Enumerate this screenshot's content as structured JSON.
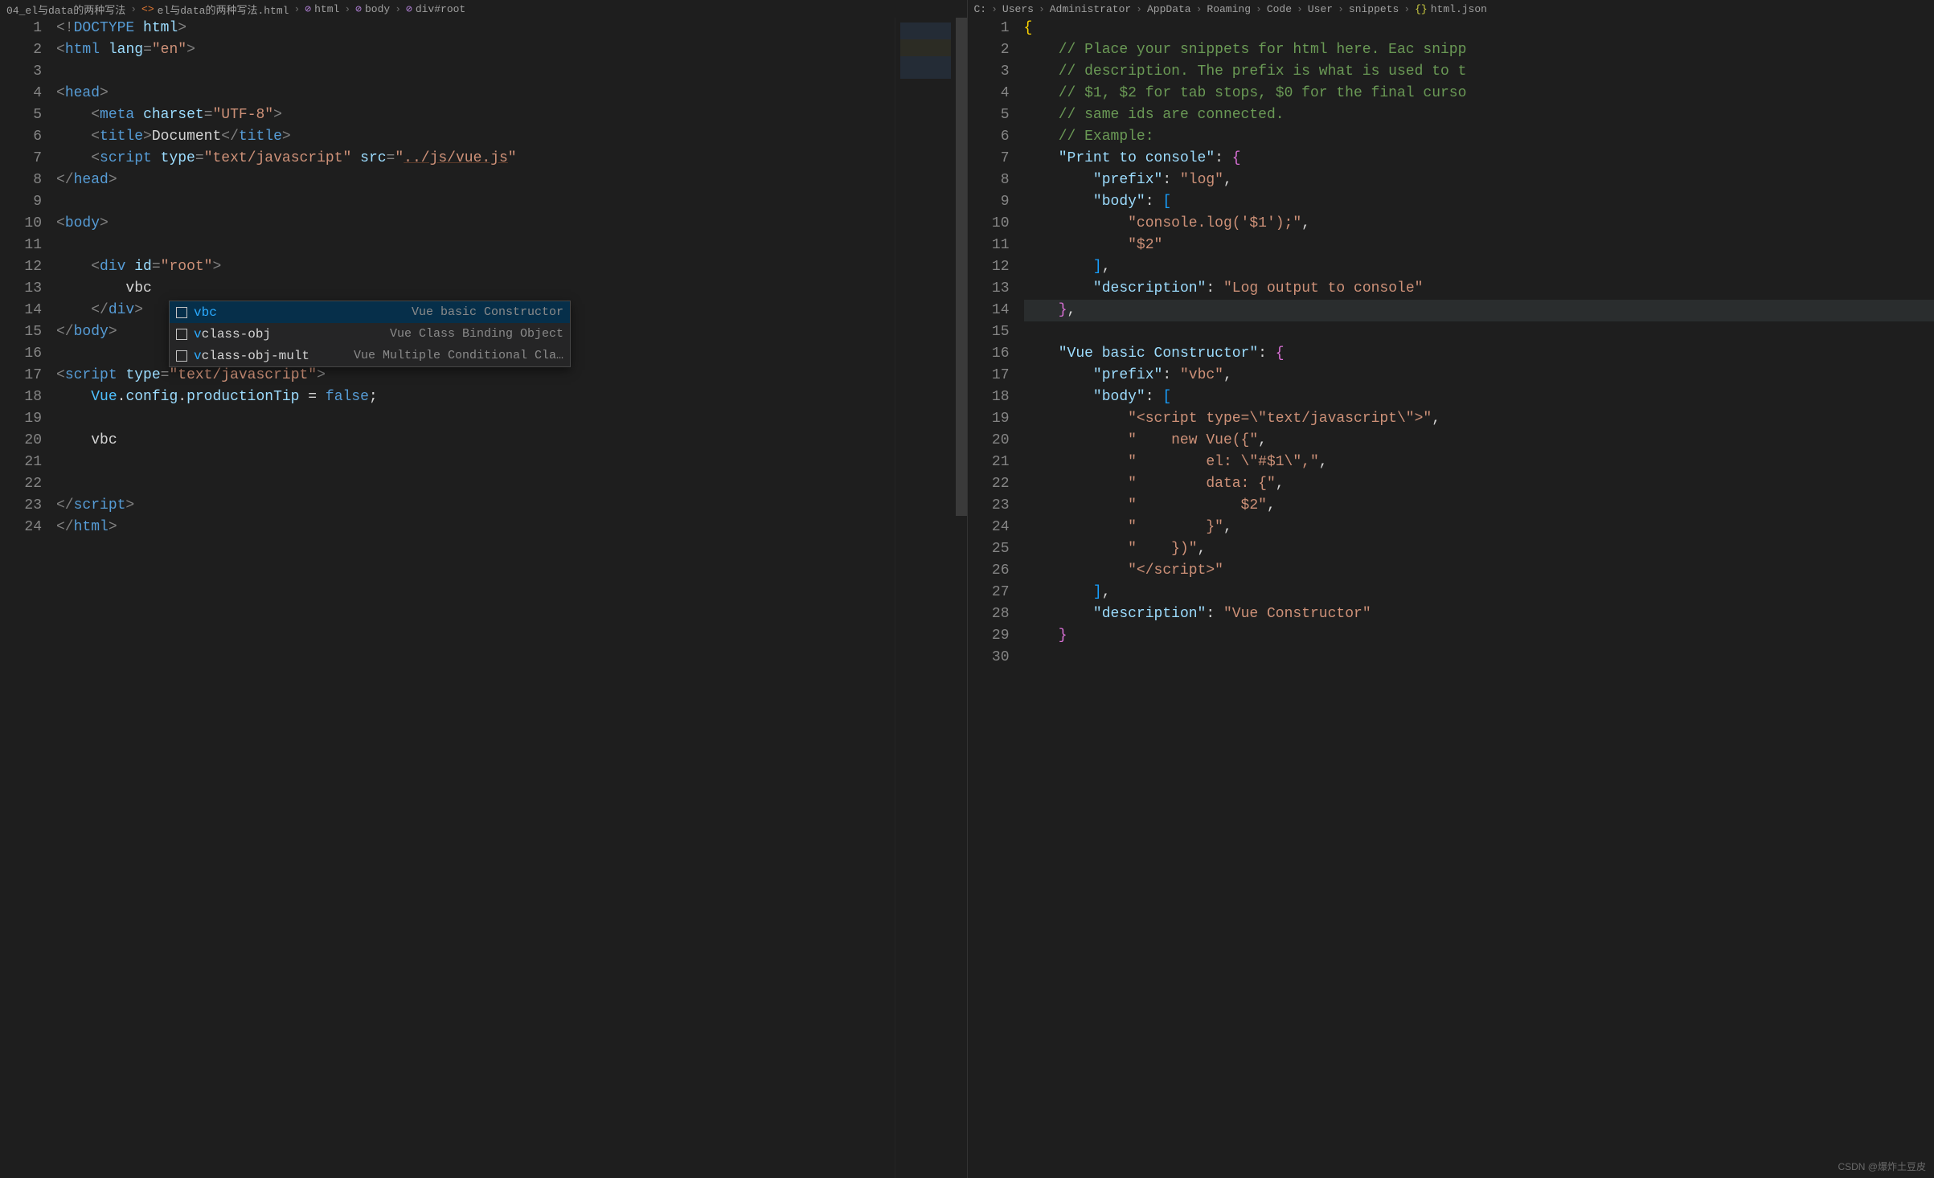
{
  "left": {
    "breadcrumbs": [
      {
        "icon": "",
        "label": "04_el与data的两种写法"
      },
      {
        "icon": "<>",
        "iconClass": "icon-html",
        "label": "el与data的两种写法.html"
      },
      {
        "icon": "⊘",
        "iconClass": "icon-sym",
        "label": "html"
      },
      {
        "icon": "⊘",
        "iconClass": "icon-sym",
        "label": "body"
      },
      {
        "icon": "⊘",
        "iconClass": "icon-sym",
        "label": "div#root"
      }
    ],
    "lineCount": 24,
    "code": {
      "l1": [
        [
          "<!",
          "t-pun"
        ],
        [
          "DOCTYPE",
          "t-tag"
        ],
        [
          " ",
          "t-txt"
        ],
        [
          "html",
          "t-attr"
        ],
        [
          ">",
          "t-pun"
        ]
      ],
      "l2": [
        [
          "<",
          "t-pun"
        ],
        [
          "html",
          "t-tag"
        ],
        [
          " ",
          "t-txt"
        ],
        [
          "lang",
          "t-attr"
        ],
        [
          "=",
          "t-pun"
        ],
        [
          "\"en\"",
          "t-str"
        ],
        [
          ">",
          "t-pun"
        ]
      ],
      "l3": [
        [
          "",
          "t-txt"
        ]
      ],
      "l4": [
        [
          "<",
          "t-pun"
        ],
        [
          "head",
          "t-tag"
        ],
        [
          ">",
          "t-pun"
        ]
      ],
      "l5": [
        [
          "    ",
          "t-txt"
        ],
        [
          "<",
          "t-pun"
        ],
        [
          "meta",
          "t-tag"
        ],
        [
          " ",
          "t-txt"
        ],
        [
          "charset",
          "t-attr"
        ],
        [
          "=",
          "t-pun"
        ],
        [
          "\"UTF-8\"",
          "t-str"
        ],
        [
          ">",
          "t-pun"
        ]
      ],
      "l6": [
        [
          "    ",
          "t-txt"
        ],
        [
          "<",
          "t-pun"
        ],
        [
          "title",
          "t-tag"
        ],
        [
          ">",
          "t-pun"
        ],
        [
          "Document",
          "t-txt"
        ],
        [
          "</",
          "t-pun"
        ],
        [
          "title",
          "t-tag"
        ],
        [
          ">",
          "t-pun"
        ]
      ],
      "l7": [
        [
          "    ",
          "t-txt"
        ],
        [
          "<",
          "t-pun"
        ],
        [
          "script",
          "t-tag"
        ],
        [
          " ",
          "t-txt"
        ],
        [
          "type",
          "t-attr"
        ],
        [
          "=",
          "t-pun"
        ],
        [
          "\"text/javascript\"",
          "t-str"
        ],
        [
          " ",
          "t-txt"
        ],
        [
          "src",
          "t-attr"
        ],
        [
          "=",
          "t-pun"
        ],
        [
          "\"",
          "t-str"
        ],
        [
          "../js/vue.js",
          "t-link"
        ],
        [
          "\"",
          "t-str"
        ]
      ],
      "l8": [
        [
          "</",
          "t-pun"
        ],
        [
          "head",
          "t-tag"
        ],
        [
          ">",
          "t-pun"
        ]
      ],
      "l9": [
        [
          "",
          "t-txt"
        ]
      ],
      "l10": [
        [
          "<",
          "t-pun"
        ],
        [
          "body",
          "t-tag"
        ],
        [
          ">",
          "t-pun"
        ]
      ],
      "l11": [
        [
          "",
          "t-txt"
        ]
      ],
      "l12": [
        [
          "    ",
          "t-txt"
        ],
        [
          "<",
          "t-pun"
        ],
        [
          "div",
          "t-tag"
        ],
        [
          " ",
          "t-txt"
        ],
        [
          "id",
          "t-attr"
        ],
        [
          "=",
          "t-pun"
        ],
        [
          "\"root\"",
          "t-str"
        ],
        [
          ">",
          "t-pun"
        ]
      ],
      "l13": [
        [
          "        vbc",
          "t-txt"
        ]
      ],
      "l14": [
        [
          "    ",
          "t-txt"
        ],
        [
          "</",
          "t-pun"
        ],
        [
          "div",
          "t-tag"
        ],
        [
          ">",
          "t-pun"
        ]
      ],
      "l15": [
        [
          "</",
          "t-pun"
        ],
        [
          "body",
          "t-tag"
        ],
        [
          ">",
          "t-pun"
        ]
      ],
      "l16": [
        [
          "",
          "t-txt"
        ]
      ],
      "l17": [
        [
          "<",
          "t-pun"
        ],
        [
          "script",
          "t-tag"
        ],
        [
          " ",
          "t-txt"
        ],
        [
          "type",
          "t-attr"
        ],
        [
          "=",
          "t-pun"
        ],
        [
          "\"text/javascript\"",
          "t-str"
        ],
        [
          ">",
          "t-pun"
        ]
      ],
      "l18": [
        [
          "    ",
          "t-txt"
        ],
        [
          "Vue",
          "t-var"
        ],
        [
          ".",
          "t-txt"
        ],
        [
          "config",
          "t-prop"
        ],
        [
          ".",
          "t-txt"
        ],
        [
          "productionTip",
          "t-prop"
        ],
        [
          " = ",
          "t-txt"
        ],
        [
          "false",
          "t-bool"
        ],
        [
          ";",
          "t-txt"
        ]
      ],
      "l19": [
        [
          "",
          "t-txt"
        ]
      ],
      "l20": [
        [
          "    ",
          "t-txt"
        ],
        [
          "vbc",
          "t-txt"
        ]
      ],
      "l21": [
        [
          "",
          "t-txt"
        ]
      ],
      "l22": [
        [
          "",
          "t-txt"
        ]
      ],
      "l23": [
        [
          "</",
          "t-pun"
        ],
        [
          "script",
          "t-tag"
        ],
        [
          ">",
          "t-pun"
        ]
      ],
      "l24": [
        [
          "</",
          "t-pun"
        ],
        [
          "html",
          "t-tag"
        ],
        [
          ">",
          "t-pun"
        ]
      ]
    },
    "suggest": [
      {
        "name": "vbc",
        "match": "vbc",
        "desc": "Vue basic Constructor",
        "selected": true
      },
      {
        "name": "vclass-obj",
        "match": "v",
        "desc": "Vue Class Binding Object",
        "selected": false
      },
      {
        "name": "vclass-obj-mult",
        "match": "v",
        "desc": "Vue Multiple Conditional Cla…",
        "selected": false
      }
    ]
  },
  "right": {
    "breadcrumbs": [
      {
        "label": "C:"
      },
      {
        "label": "Users"
      },
      {
        "label": "Administrator"
      },
      {
        "label": "AppData"
      },
      {
        "label": "Roaming"
      },
      {
        "label": "Code"
      },
      {
        "label": "User"
      },
      {
        "label": "snippets"
      },
      {
        "icon": "{}",
        "iconClass": "icon-json",
        "label": "html.json"
      }
    ],
    "lineCount": 30,
    "code": {
      "l1": [
        [
          "{",
          "t-brace"
        ]
      ],
      "l2": [
        [
          "    ",
          "t-txt"
        ],
        [
          "// Place your snippets for html here. Eac snipp",
          "t-com"
        ]
      ],
      "l3": [
        [
          "    ",
          "t-txt"
        ],
        [
          "// description. The prefix is what is used to t",
          "t-com"
        ]
      ],
      "l4": [
        [
          "    ",
          "t-txt"
        ],
        [
          "// $1, $2 for tab stops, $0 for the final curso",
          "t-com"
        ]
      ],
      "l5": [
        [
          "    ",
          "t-txt"
        ],
        [
          "// same ids are connected.",
          "t-com"
        ]
      ],
      "l6": [
        [
          "    ",
          "t-txt"
        ],
        [
          "// Example:",
          "t-com"
        ]
      ],
      "l7": [
        [
          "    ",
          "t-txt"
        ],
        [
          "\"Print to console\"",
          "t-key"
        ],
        [
          ":",
          "t-txt"
        ],
        [
          " ",
          "t-txt"
        ],
        [
          "{",
          "t-brace2"
        ]
      ],
      "l8": [
        [
          "        ",
          "t-txt"
        ],
        [
          "\"prefix\"",
          "t-key"
        ],
        [
          ":",
          "t-txt"
        ],
        [
          " ",
          "t-txt"
        ],
        [
          "\"log\"",
          "t-str"
        ],
        [
          ",",
          "t-txt"
        ]
      ],
      "l9": [
        [
          "        ",
          "t-txt"
        ],
        [
          "\"body\"",
          "t-key"
        ],
        [
          ":",
          "t-txt"
        ],
        [
          " ",
          "t-txt"
        ],
        [
          "[",
          "t-brace3"
        ]
      ],
      "l10": [
        [
          "            ",
          "t-txt"
        ],
        [
          "\"console.log('$1');\"",
          "t-str"
        ],
        [
          ",",
          "t-txt"
        ]
      ],
      "l11": [
        [
          "            ",
          "t-txt"
        ],
        [
          "\"$2\"",
          "t-str"
        ]
      ],
      "l12": [
        [
          "        ",
          "t-txt"
        ],
        [
          "]",
          "t-brace3"
        ],
        [
          ",",
          "t-txt"
        ]
      ],
      "l13": [
        [
          "        ",
          "t-txt"
        ],
        [
          "\"description\"",
          "t-key"
        ],
        [
          ":",
          "t-txt"
        ],
        [
          " ",
          "t-txt"
        ],
        [
          "\"Log output to console\"",
          "t-str"
        ]
      ],
      "l14": [
        [
          "    ",
          "t-txt"
        ],
        [
          "}",
          "t-brace2"
        ],
        [
          ",",
          "t-txt"
        ]
      ],
      "l15": [
        [
          "",
          "t-txt"
        ]
      ],
      "l16": [
        [
          "    ",
          "t-txt"
        ],
        [
          "\"Vue basic Constructor\"",
          "t-key"
        ],
        [
          ":",
          "t-txt"
        ],
        [
          " ",
          "t-txt"
        ],
        [
          "{",
          "t-brace2"
        ]
      ],
      "l17": [
        [
          "        ",
          "t-txt"
        ],
        [
          "\"prefix\"",
          "t-key"
        ],
        [
          ":",
          "t-txt"
        ],
        [
          " ",
          "t-txt"
        ],
        [
          "\"vbc\"",
          "t-str"
        ],
        [
          ",",
          "t-txt"
        ]
      ],
      "l18": [
        [
          "        ",
          "t-txt"
        ],
        [
          "\"body\"",
          "t-key"
        ],
        [
          ":",
          "t-txt"
        ],
        [
          " ",
          "t-txt"
        ],
        [
          "[",
          "t-brace3"
        ]
      ],
      "l19": [
        [
          "            ",
          "t-txt"
        ],
        [
          "\"<script type=\\\"text/javascript\\\">\"",
          "t-str"
        ],
        [
          ",",
          "t-txt"
        ]
      ],
      "l20": [
        [
          "            ",
          "t-txt"
        ],
        [
          "\"    new Vue({\"",
          "t-str"
        ],
        [
          ",",
          "t-txt"
        ]
      ],
      "l21": [
        [
          "            ",
          "t-txt"
        ],
        [
          "\"        el: \\\"#$1\\\",\"",
          "t-str"
        ],
        [
          ",",
          "t-txt"
        ]
      ],
      "l22": [
        [
          "            ",
          "t-txt"
        ],
        [
          "\"        data: {\"",
          "t-str"
        ],
        [
          ",",
          "t-txt"
        ]
      ],
      "l23": [
        [
          "            ",
          "t-txt"
        ],
        [
          "\"            $2\"",
          "t-str"
        ],
        [
          ",",
          "t-txt"
        ]
      ],
      "l24": [
        [
          "            ",
          "t-txt"
        ],
        [
          "\"        }\"",
          "t-str"
        ],
        [
          ",",
          "t-txt"
        ]
      ],
      "l25": [
        [
          "            ",
          "t-txt"
        ],
        [
          "\"    })\"",
          "t-str"
        ],
        [
          ",",
          "t-txt"
        ]
      ],
      "l26": [
        [
          "            ",
          "t-txt"
        ],
        [
          "\"</​script>\"",
          "t-str"
        ]
      ],
      "l27": [
        [
          "        ",
          "t-txt"
        ],
        [
          "]",
          "t-brace3"
        ],
        [
          ",",
          "t-txt"
        ]
      ],
      "l28": [
        [
          "        ",
          "t-txt"
        ],
        [
          "\"description\"",
          "t-key"
        ],
        [
          ":",
          "t-txt"
        ],
        [
          " ",
          "t-txt"
        ],
        [
          "\"Vue Constructor\"",
          "t-str"
        ]
      ],
      "l29": [
        [
          "    ",
          "t-txt"
        ],
        [
          "}",
          "t-brace2"
        ]
      ],
      "l30": [
        [
          "",
          "t-txt"
        ]
      ]
    },
    "highlightLine": 14
  },
  "watermark": "CSDN @爆炸土豆皮"
}
